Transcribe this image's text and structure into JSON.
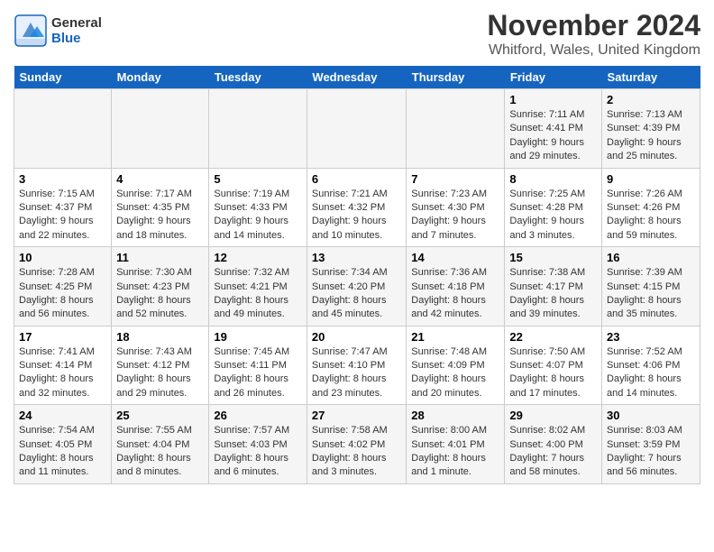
{
  "header": {
    "logo_line1": "General",
    "logo_line2": "Blue",
    "main_title": "November 2024",
    "subtitle": "Whitford, Wales, United Kingdom"
  },
  "days_of_week": [
    "Sunday",
    "Monday",
    "Tuesday",
    "Wednesday",
    "Thursday",
    "Friday",
    "Saturday"
  ],
  "weeks": [
    [
      {
        "day": "",
        "info": ""
      },
      {
        "day": "",
        "info": ""
      },
      {
        "day": "",
        "info": ""
      },
      {
        "day": "",
        "info": ""
      },
      {
        "day": "",
        "info": ""
      },
      {
        "day": "1",
        "info": "Sunrise: 7:11 AM\nSunset: 4:41 PM\nDaylight: 9 hours and 29 minutes."
      },
      {
        "day": "2",
        "info": "Sunrise: 7:13 AM\nSunset: 4:39 PM\nDaylight: 9 hours and 25 minutes."
      }
    ],
    [
      {
        "day": "3",
        "info": "Sunrise: 7:15 AM\nSunset: 4:37 PM\nDaylight: 9 hours and 22 minutes."
      },
      {
        "day": "4",
        "info": "Sunrise: 7:17 AM\nSunset: 4:35 PM\nDaylight: 9 hours and 18 minutes."
      },
      {
        "day": "5",
        "info": "Sunrise: 7:19 AM\nSunset: 4:33 PM\nDaylight: 9 hours and 14 minutes."
      },
      {
        "day": "6",
        "info": "Sunrise: 7:21 AM\nSunset: 4:32 PM\nDaylight: 9 hours and 10 minutes."
      },
      {
        "day": "7",
        "info": "Sunrise: 7:23 AM\nSunset: 4:30 PM\nDaylight: 9 hours and 7 minutes."
      },
      {
        "day": "8",
        "info": "Sunrise: 7:25 AM\nSunset: 4:28 PM\nDaylight: 9 hours and 3 minutes."
      },
      {
        "day": "9",
        "info": "Sunrise: 7:26 AM\nSunset: 4:26 PM\nDaylight: 8 hours and 59 minutes."
      }
    ],
    [
      {
        "day": "10",
        "info": "Sunrise: 7:28 AM\nSunset: 4:25 PM\nDaylight: 8 hours and 56 minutes."
      },
      {
        "day": "11",
        "info": "Sunrise: 7:30 AM\nSunset: 4:23 PM\nDaylight: 8 hours and 52 minutes."
      },
      {
        "day": "12",
        "info": "Sunrise: 7:32 AM\nSunset: 4:21 PM\nDaylight: 8 hours and 49 minutes."
      },
      {
        "day": "13",
        "info": "Sunrise: 7:34 AM\nSunset: 4:20 PM\nDaylight: 8 hours and 45 minutes."
      },
      {
        "day": "14",
        "info": "Sunrise: 7:36 AM\nSunset: 4:18 PM\nDaylight: 8 hours and 42 minutes."
      },
      {
        "day": "15",
        "info": "Sunrise: 7:38 AM\nSunset: 4:17 PM\nDaylight: 8 hours and 39 minutes."
      },
      {
        "day": "16",
        "info": "Sunrise: 7:39 AM\nSunset: 4:15 PM\nDaylight: 8 hours and 35 minutes."
      }
    ],
    [
      {
        "day": "17",
        "info": "Sunrise: 7:41 AM\nSunset: 4:14 PM\nDaylight: 8 hours and 32 minutes."
      },
      {
        "day": "18",
        "info": "Sunrise: 7:43 AM\nSunset: 4:12 PM\nDaylight: 8 hours and 29 minutes."
      },
      {
        "day": "19",
        "info": "Sunrise: 7:45 AM\nSunset: 4:11 PM\nDaylight: 8 hours and 26 minutes."
      },
      {
        "day": "20",
        "info": "Sunrise: 7:47 AM\nSunset: 4:10 PM\nDaylight: 8 hours and 23 minutes."
      },
      {
        "day": "21",
        "info": "Sunrise: 7:48 AM\nSunset: 4:09 PM\nDaylight: 8 hours and 20 minutes."
      },
      {
        "day": "22",
        "info": "Sunrise: 7:50 AM\nSunset: 4:07 PM\nDaylight: 8 hours and 17 minutes."
      },
      {
        "day": "23",
        "info": "Sunrise: 7:52 AM\nSunset: 4:06 PM\nDaylight: 8 hours and 14 minutes."
      }
    ],
    [
      {
        "day": "24",
        "info": "Sunrise: 7:54 AM\nSunset: 4:05 PM\nDaylight: 8 hours and 11 minutes."
      },
      {
        "day": "25",
        "info": "Sunrise: 7:55 AM\nSunset: 4:04 PM\nDaylight: 8 hours and 8 minutes."
      },
      {
        "day": "26",
        "info": "Sunrise: 7:57 AM\nSunset: 4:03 PM\nDaylight: 8 hours and 6 minutes."
      },
      {
        "day": "27",
        "info": "Sunrise: 7:58 AM\nSunset: 4:02 PM\nDaylight: 8 hours and 3 minutes."
      },
      {
        "day": "28",
        "info": "Sunrise: 8:00 AM\nSunset: 4:01 PM\nDaylight: 8 hours and 1 minute."
      },
      {
        "day": "29",
        "info": "Sunrise: 8:02 AM\nSunset: 4:00 PM\nDaylight: 7 hours and 58 minutes."
      },
      {
        "day": "30",
        "info": "Sunrise: 8:03 AM\nSunset: 3:59 PM\nDaylight: 7 hours and 56 minutes."
      }
    ]
  ]
}
